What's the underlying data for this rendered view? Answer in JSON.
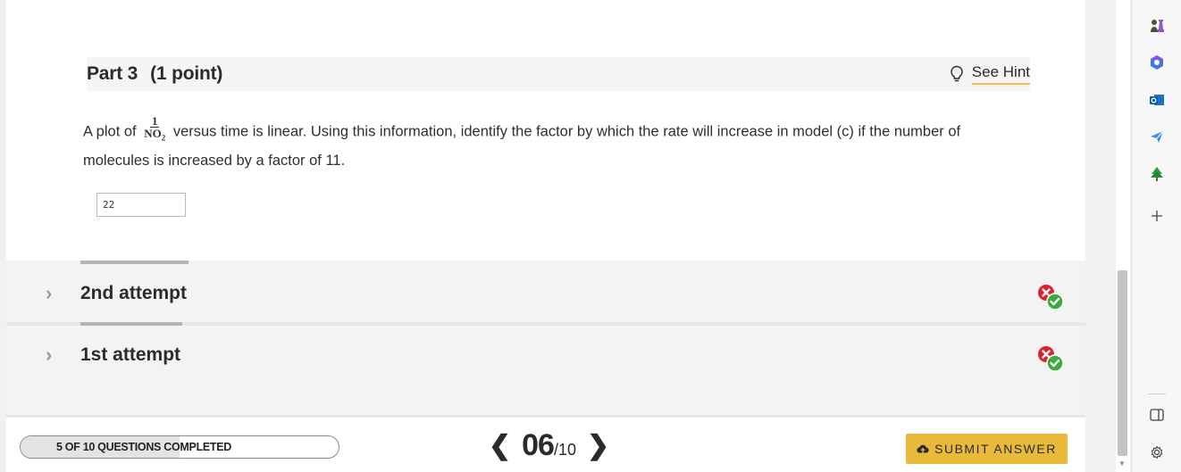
{
  "part": {
    "title": "Part 3",
    "points": "(1 point)",
    "hint_label": "See Hint"
  },
  "question": {
    "text_before": "A plot of",
    "fraction_numerator": "1",
    "fraction_denominator": "NO",
    "fraction_subscript": "2",
    "text_after": "versus time is linear. Using this information, identify the factor by which the rate will increase in model (c) if the number of molecules is increased by a factor of 11."
  },
  "answer": {
    "value": "22"
  },
  "attempts": [
    {
      "label": "2nd attempt",
      "status": "incorrect-correct"
    },
    {
      "label": "1st attempt",
      "status": "incorrect-correct"
    }
  ],
  "footer": {
    "progress_label": "5 OF 10 QUESTIONS COMPLETED",
    "progress_fraction": 0.5,
    "current_page": "06",
    "total_pages": "/10",
    "submit_label": "SUBMIT ANSWER"
  },
  "colors": {
    "accent_yellow": "#e8b93a",
    "hint_underline": "#f0c24b",
    "error_red": "#d9242f",
    "success_green": "#3daa3f"
  },
  "side_rail": {
    "icons": [
      "chess-icon",
      "copilot-icon",
      "outlook-icon",
      "send-icon",
      "tree-icon",
      "add-icon",
      "sidebar-toggle-icon",
      "settings-icon"
    ]
  }
}
